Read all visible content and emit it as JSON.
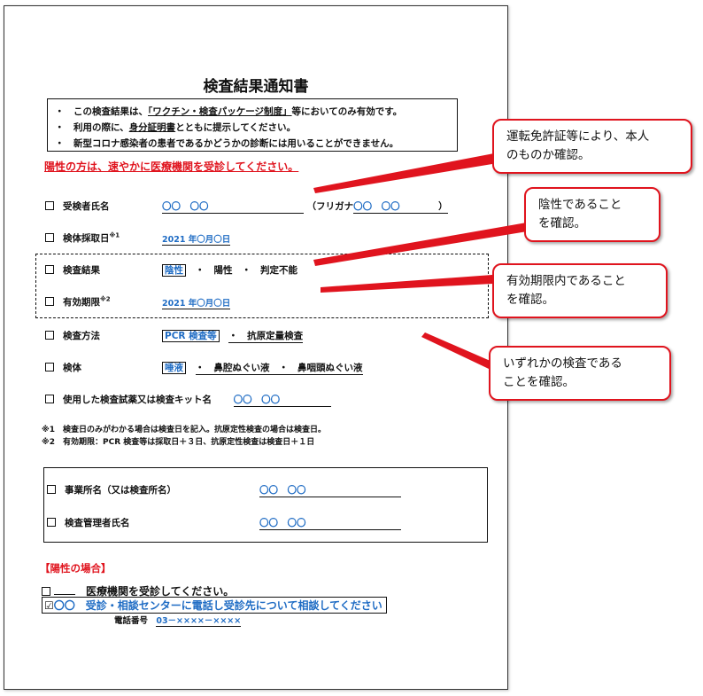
{
  "document": {
    "title": "検査結果通知書",
    "notes": [
      {
        "bullet": "・",
        "pre": "この検査結果は、",
        "ul": "「ワクチン・検査パッケージ制度」",
        "post": "等においてのみ有効です。"
      },
      {
        "bullet": "・",
        "pre": "利用の際に、",
        "ul": "身分証明書",
        "post": "とともに提示してください。"
      },
      {
        "bullet": "・",
        "pre": "新型コロナ感染者の患者であるかどうかの診断には用いることができません。",
        "ul": "",
        "post": ""
      }
    ],
    "warning": "陽性の方は、速やかに医療機関を受診してください。",
    "fields": {
      "name_label": "受検者氏名",
      "name_value": "〇〇　〇〇",
      "furigana_open": "（フリガナ",
      "furigana_value": "〇〇　〇〇",
      "furigana_close": "）",
      "sample_date_label": "検体採取日",
      "sample_date_mark": "※1",
      "sample_date_value": "2021 年〇月〇日",
      "result_label": "検査結果",
      "result_opt1": "陰性",
      "result_rest": "・　陽性　・　判定不能",
      "expiry_label": "有効期限",
      "expiry_mark": "※2",
      "expiry_value": "2021 年〇月〇日",
      "method_label": "検査方法",
      "method_opt1": "PCR 検査等",
      "method_rest": "・　抗原定量検査",
      "specimen_label": "検体",
      "specimen_opt1": "唾液",
      "specimen_rest": "・　鼻腔ぬぐい液　・　鼻咽頭ぬぐい液",
      "reagent_label": "使用した検査試薬又は検査キット名",
      "reagent_value": "〇〇　〇〇"
    },
    "footnotes": [
      "※1　検査日のみがわかる場合は検査日を記入。抗原定性検査の場合は検査日。",
      "※2　有効期限：PCR 検査等は採取日＋３日、抗原定性検査は検査日＋１日"
    ],
    "facility": {
      "office_label": "事業所名（又は検査所名）",
      "office_value": "〇〇　〇〇",
      "manager_label": "検査管理者氏名",
      "manager_value": "〇〇　〇〇"
    },
    "positive": {
      "heading": "【陽性の場合】",
      "option1": "医療機関を受診してください。",
      "option2_prefix": "〇〇",
      "option2": "受診・相談センターに電話し受診先について相談してください",
      "phone_label": "電話番号",
      "phone_value": "03－××××－××××"
    }
  },
  "callouts": [
    {
      "line1": "運転免許証等により、本人",
      "line2": "のものか確認。"
    },
    {
      "line1": "陰性であること",
      "line2": "を確認。"
    },
    {
      "line1": "有効期限内であること",
      "line2": "を確認。"
    },
    {
      "line1": "いずれかの検査である",
      "line2": "ことを確認。"
    }
  ],
  "colors": {
    "accent_red": "#e0141e",
    "value_blue": "#1f6cc4"
  }
}
